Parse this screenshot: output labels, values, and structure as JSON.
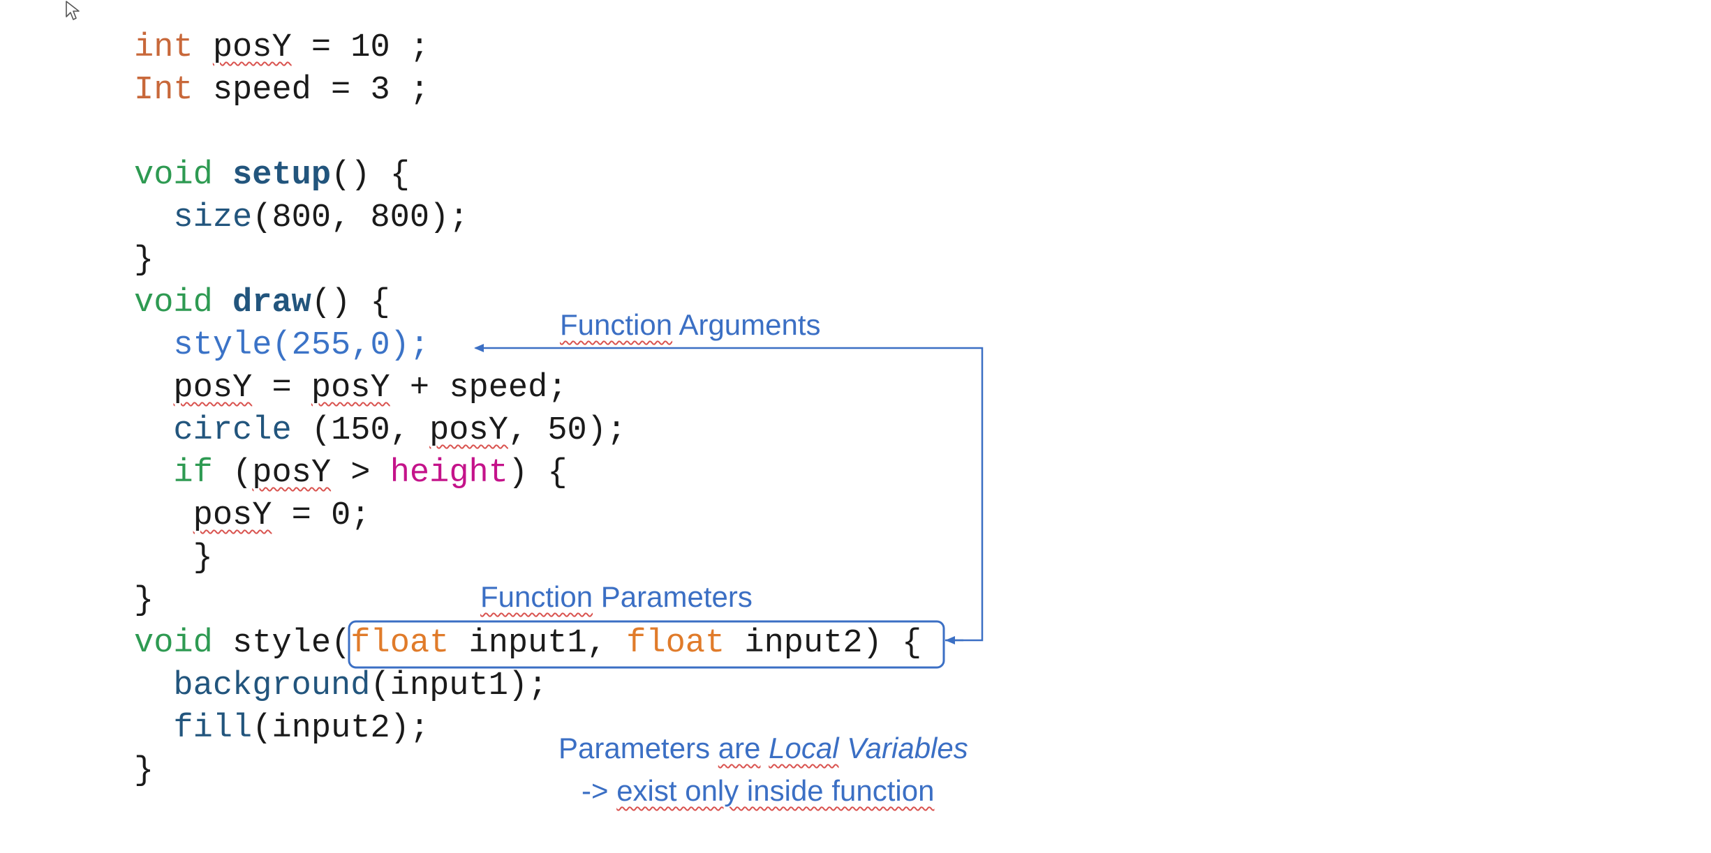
{
  "code": {
    "l1_type": "int",
    "l1_var": "posY",
    "l1_rest": " = 10 ;",
    "l2_type": "Int",
    "l2_rest": " speed = 3 ;",
    "l4_void": "void",
    "l4_name": "setup",
    "l4_rest": "() {",
    "l5_indent": "  ",
    "l5_fn": "size",
    "l5_rest": "(800, 800);",
    "l6": "}",
    "l7_void": "void",
    "l7_name": "draw",
    "l7_rest": "() {",
    "l8_indent": "  ",
    "l8_call": "style(255,0);",
    "l9_indent": "  ",
    "l9_var1": "posY",
    "l9_mid": " = ",
    "l9_var2": "posY",
    "l9_rest": " + speed;",
    "l10_indent": "  ",
    "l10_fn": "circle",
    "l10_a": " (150, ",
    "l10_var": "posY",
    "l10_b": ", 50);",
    "l11_indent": "  ",
    "l11_kw": "if",
    "l11_a": " (",
    "l11_var": "posY",
    "l11_b": " > ",
    "l11_height": "height",
    "l11_c": ") {",
    "l12_indent": "   ",
    "l12_var": "posY",
    "l12_rest": " = 0;",
    "l13": "   }",
    "l14": "}",
    "l15_void": "void",
    "l15_name": " style",
    "l15_paren": "(",
    "l15_float1": "float",
    "l15_p1": " input1, ",
    "l15_float2": "float",
    "l15_p2": " input2)",
    "l15_brace": " {",
    "l16_indent": "  ",
    "l16_fn": "background",
    "l16_rest": "(input1);",
    "l17_indent": "  ",
    "l17_fn": "fill",
    "l17_rest": "(input2);",
    "l18": "}"
  },
  "annotations": {
    "arguments_word1": "Function",
    "arguments_word2": " Arguments",
    "parameters_word1": "Function",
    "parameters_word2": " Parameters",
    "local_line1_a": "Parameters ",
    "local_line1_b": "are",
    "local_line1_c": " ",
    "local_line1_local": "Local",
    "local_line1_d": " Variables",
    "local_line2_a": "-> ",
    "local_line2_b": "exist only inside function"
  },
  "colors": {
    "annotation_blue": "#3b6fc4",
    "type_orange": "#c8683a",
    "void_green": "#2e9a52",
    "function_navy": "#22557d",
    "height_pink": "#c4138a",
    "float_orange": "#e07b2a",
    "spellcheck_red": "#d9534f"
  },
  "icons": {
    "cursor": "mouse-pointer-icon"
  }
}
